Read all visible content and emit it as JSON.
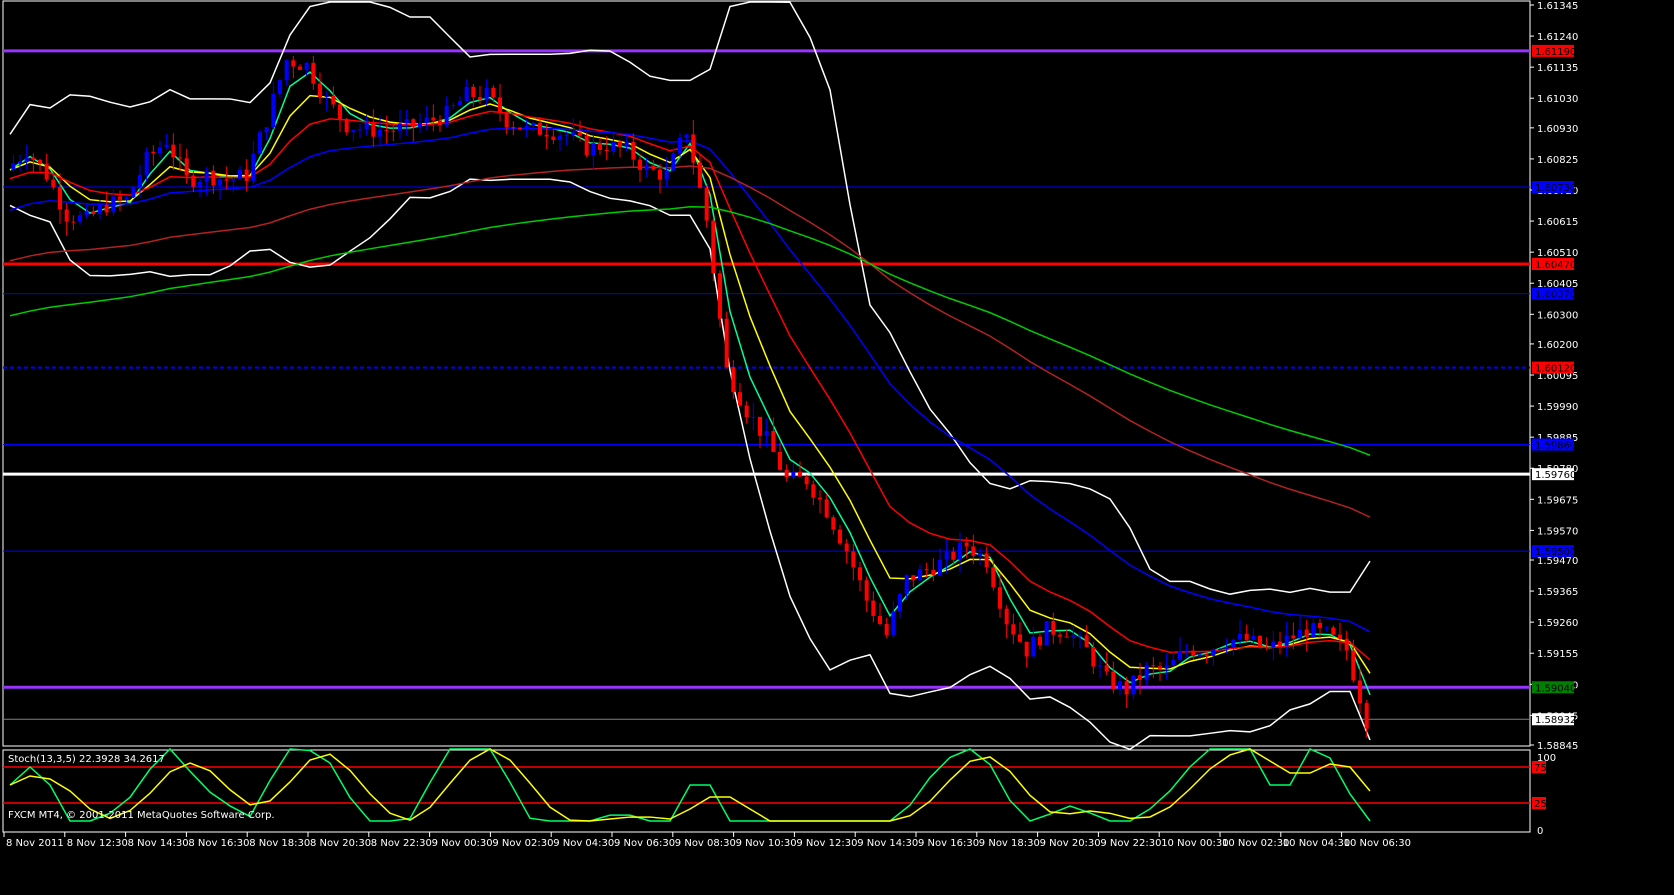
{
  "chart_data": {
    "type": "candlestick",
    "symbol_info": "FXCM MT4, © 2001-2011 MetaQuotes Software Corp.",
    "price_range": [
      1.58845,
      1.61345
    ],
    "price_ticks": [
      "1.61345",
      "1.61240",
      "1.61135",
      "1.61030",
      "1.60930",
      "1.60825",
      "1.60720",
      "1.60615",
      "1.60510",
      "1.60405",
      "1.60300",
      "1.60200",
      "1.60095",
      "1.59990",
      "1.59885",
      "1.59780",
      "1.59675",
      "1.59570",
      "1.59470",
      "1.59365",
      "1.59260",
      "1.59155",
      "1.59050",
      "1.58945",
      "1.58845"
    ],
    "time_labels": [
      "8 Nov 2011",
      "8 Nov 12:30",
      "8 Nov 14:30",
      "8 Nov 16:30",
      "8 Nov 18:30",
      "8 Nov 20:30",
      "8 Nov 22:30",
      "9 Nov 00:30",
      "9 Nov 02:30",
      "9 Nov 04:30",
      "9 Nov 06:30",
      "9 Nov 08:30",
      "9 Nov 10:30",
      "9 Nov 12:30",
      "9 Nov 14:30",
      "9 Nov 16:30",
      "9 Nov 18:30",
      "9 Nov 20:30",
      "9 Nov 22:30",
      "10 Nov 00:30",
      "10 Nov 02:30",
      "10 Nov 04:30",
      "10 Nov 06:30"
    ],
    "closes": [
      1.60788,
      1.60855,
      1.60771,
      1.60636,
      1.60619,
      1.6067,
      1.60686,
      1.60822,
      1.60889,
      1.60754,
      1.60771,
      1.60754,
      1.60771,
      1.60957,
      1.61159,
      1.61142,
      1.61024,
      1.6094,
      1.60923,
      1.60923,
      1.6093,
      1.6095,
      1.60974,
      1.61041,
      1.61041,
      1.60957,
      1.60923,
      1.60923,
      1.60906,
      1.60862,
      1.60872,
      1.60855,
      1.60788,
      1.60771,
      1.60923,
      1.60619,
      1.60112,
      1.59977,
      1.59876,
      1.59741,
      1.59741,
      1.59639,
      1.59504,
      1.59335,
      1.59217,
      1.59403,
      1.59437,
      1.5947,
      1.59521,
      1.5947,
      1.59268,
      1.59166,
      1.59234,
      1.59234,
      1.59166,
      1.59065,
      1.59031,
      1.59099,
      1.59099,
      1.59166,
      1.59166,
      1.592,
      1.592,
      1.59166,
      1.592,
      1.59234,
      1.59217,
      1.59166,
      1.5893
    ],
    "moving_averages": [
      {
        "period": 2,
        "color": "#00ff99",
        "seed": 1.60788
      },
      {
        "period": 4,
        "color": "#ffff00",
        "seed": 1.60788
      },
      {
        "period": 8,
        "color": "#ff0000",
        "seed": 1.6075
      },
      {
        "period": 18,
        "color": "#0000ff",
        "seed": 1.60636
      },
      {
        "period": 45,
        "color": "#b22222",
        "seed": 1.60467
      },
      {
        "period": 70,
        "color": "#00cc00",
        "seed": 1.60281
      }
    ],
    "bollinger": {
      "period": 8,
      "deviations": 2,
      "color": "#ffffff"
    },
    "horizontal_lines": [
      {
        "price": 1.6119,
        "label": "1.61190",
        "color": "#9933ff",
        "label_bg": "#ff0000",
        "width": 3
      },
      {
        "price": 1.6073,
        "label": "1.60730",
        "color": "#0000ff",
        "label_bg": "#0000ff",
        "width": 1
      },
      {
        "price": 1.6047,
        "label": "1.60470",
        "color": "#ff0000",
        "label_bg": "#ff0000",
        "width": 3
      },
      {
        "price": 1.6037,
        "label": "1.60370",
        "color": "#0000ff",
        "label_bg": "#0000ff",
        "width": 1
      },
      {
        "price": 1.6012,
        "label": "1.60120",
        "color": "#0000ff",
        "label_bg": "#ff0000",
        "width": 2,
        "dashed": true
      },
      {
        "price": 1.5986,
        "label": "1.59860",
        "color": "#0000ff",
        "label_bg": "#0000ff",
        "width": 1
      },
      {
        "price": 1.5976,
        "label": "1.59760",
        "color": "#ffffff",
        "label_bg": "#ffffff",
        "width": 3
      },
      {
        "price": 1.595,
        "label": "1.59500",
        "color": "#0000ff",
        "label_bg": "#0000ff",
        "width": 1
      },
      {
        "price": 1.5904,
        "label": "1.59040",
        "color": "#9933ff",
        "label_bg": "#008000",
        "width": 3
      },
      {
        "price": 1.58932,
        "label": "1.58932",
        "color": "#808080",
        "label_bg": "#ffffff",
        "width": 1
      }
    ],
    "stochastic": {
      "label": "Stoch(13,3,5) 22.3928 34.2617",
      "levels": [
        "75",
        "25"
      ],
      "scale": [
        "100",
        "0"
      ],
      "k_color": "#00ff66",
      "d_color": "#ffff00",
      "period": 5
    },
    "colors": {
      "bull": "#0000ff",
      "bear": "#ff0000",
      "background": "#000000",
      "axis": "#ffffff"
    }
  }
}
